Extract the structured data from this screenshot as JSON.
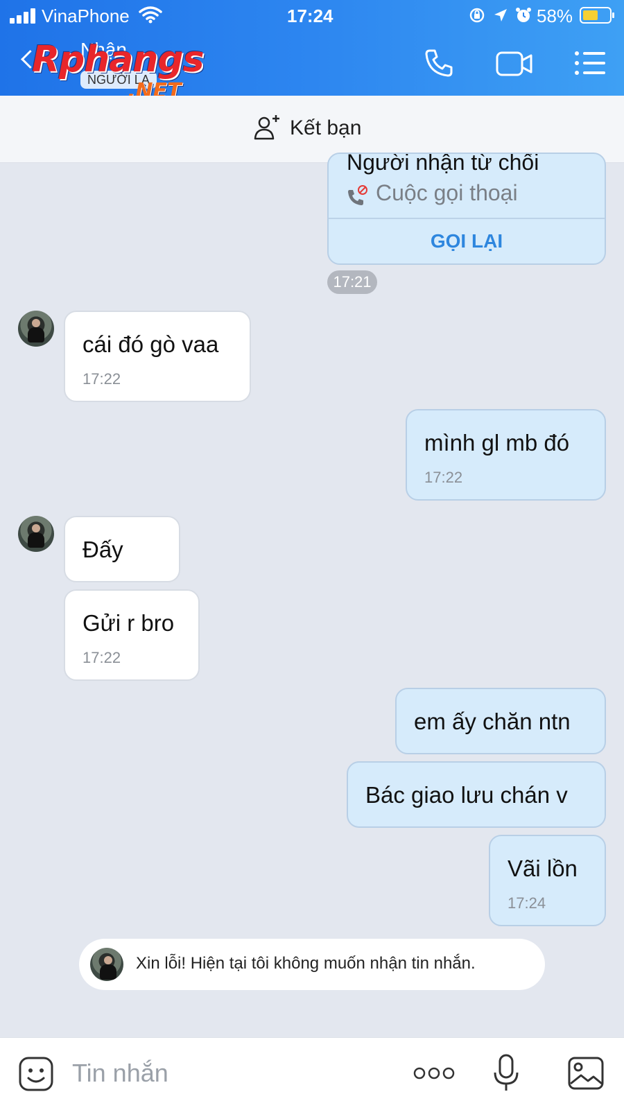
{
  "status_bar": {
    "carrier": "VinaPhone",
    "time": "17:24",
    "battery_percent": "58%",
    "battery_level": 0.58
  },
  "header": {
    "back_label": "",
    "contact_name": "Nhận",
    "stranger_badge": "NGƯỜI LẠ",
    "watermark_text": "Rphangs",
    "watermark_suffix": ".NET",
    "colors": {
      "gradient_start": "#1f73e8",
      "gradient_end": "#3ea0f4"
    },
    "icons": [
      "phone-icon",
      "video-call-icon",
      "menu-list-icon"
    ]
  },
  "add_friend_bar": {
    "label": "Kết bạn",
    "icon": "add-person-icon"
  },
  "messages": {
    "call_card": {
      "title": "Người nhận từ chối",
      "subtitle": "Cuộc gọi thoại",
      "action": "GỌI LẠI",
      "time": "17:21"
    },
    "items": [
      {
        "side": "in",
        "text": "cái đó gò vaa",
        "time": "17:22"
      },
      {
        "side": "out",
        "text": "mình gl mb đó",
        "time": "17:22"
      },
      {
        "side": "in",
        "text": "Đấy",
        "time": ""
      },
      {
        "side": "in",
        "text": "Gửi r bro",
        "time": "17:22"
      },
      {
        "side": "out",
        "text": "em ấy chăn ntn",
        "time": ""
      },
      {
        "side": "out",
        "text": "Bác giao lưu chán v",
        "time": ""
      },
      {
        "side": "out",
        "text": "Vãi lồn",
        "time": "17:24"
      }
    ],
    "auto_reply": "Xin lỗi! Hiện tại tôi không muốn nhận tin nhắn."
  },
  "input_bar": {
    "placeholder": "Tin nhắn",
    "icons": [
      "sticker-icon",
      "more-options-icon",
      "microphone-icon",
      "image-icon"
    ]
  }
}
